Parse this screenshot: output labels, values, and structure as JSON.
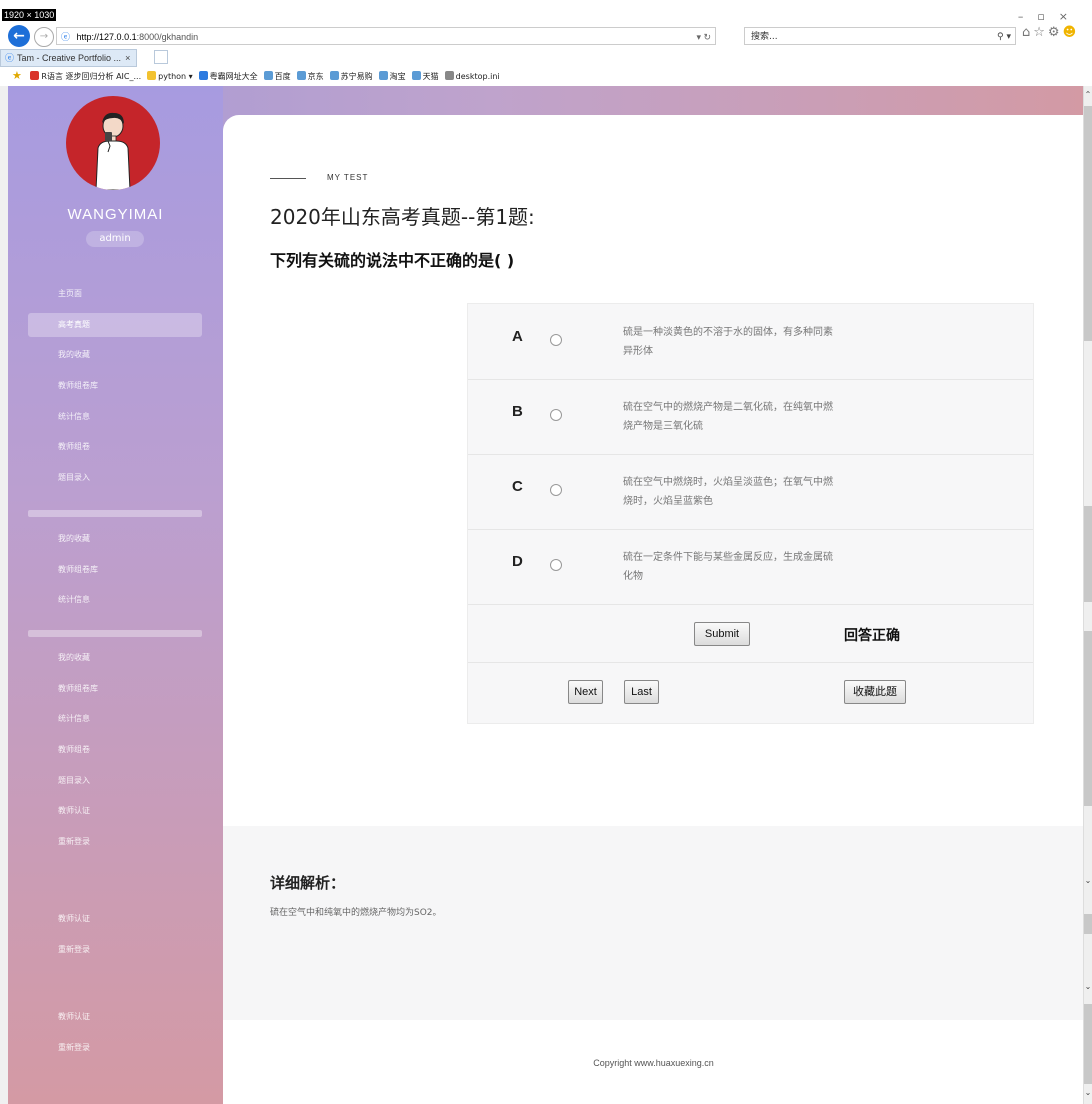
{
  "browser": {
    "resolution_label": "1920 × 1030",
    "url_host": "http://127.0.0.1",
    "url_path": ":8000/gkhandin",
    "search_placeholder": "搜索...",
    "tab_title": "Tam - Creative Portfolio ...",
    "favorites": [
      "R语言 逐步回归分析 AIC_...",
      "python ▾",
      "粤霸网址大全",
      "百度",
      "京东",
      "苏宁易购",
      "淘宝",
      "天猫",
      "desktop.ini"
    ],
    "favorite_colors": [
      "#d9342b",
      "#f2c230",
      "#2d7be0",
      "#5b9bd5",
      "#5b9bd5",
      "#5b9bd5",
      "#5b9bd5",
      "#5b9bd5",
      "#888888"
    ]
  },
  "sidebar": {
    "username": "WANGYIMAI",
    "role": "admin",
    "menu_group1": [
      "主页面",
      "高考真题",
      "我的收藏",
      "教师组卷库",
      "统计信息",
      "教师组卷",
      "题目录入"
    ],
    "menu_group2": [
      "我的收藏",
      "教师组卷库",
      "统计信息"
    ],
    "menu_group3": [
      "我的收藏",
      "教师组卷库",
      "统计信息",
      "教师组卷",
      "题目录入",
      "教师认证",
      "重新登录"
    ],
    "menu_group4": [
      "教师认证",
      "重新登录"
    ],
    "menu_group5": [
      "教师认证",
      "重新登录"
    ]
  },
  "main": {
    "kicker": "MY TEST",
    "title": "2020年山东高考真题--第1题:",
    "question": "下列有关硫的说法中不正确的是(      )",
    "options": [
      {
        "letter": "A",
        "text": "硫是一种淡黄色的不溶于水的固体，有多种同素异形体"
      },
      {
        "letter": "B",
        "text": "硫在空气中的燃烧产物是二氧化硫，在纯氧中燃烧产物是三氧化硫"
      },
      {
        "letter": "C",
        "text": "硫在空气中燃烧时，火焰呈淡蓝色；在氧气中燃烧时，火焰呈蓝紫色"
      },
      {
        "letter": "D",
        "text": "硫在一定条件下能与某些金属反应，生成金属硫化物"
      }
    ],
    "submit_label": "Submit",
    "result": "回答正确",
    "next_label": "Next",
    "last_label": "Last",
    "favorite_label": "收藏此题"
  },
  "analysis": {
    "heading": "详细解析：",
    "text": "硫在空气中和纯氧中的燃烧产物均为SO2。"
  },
  "footer": "Copyright www.huaxuexing.cn"
}
